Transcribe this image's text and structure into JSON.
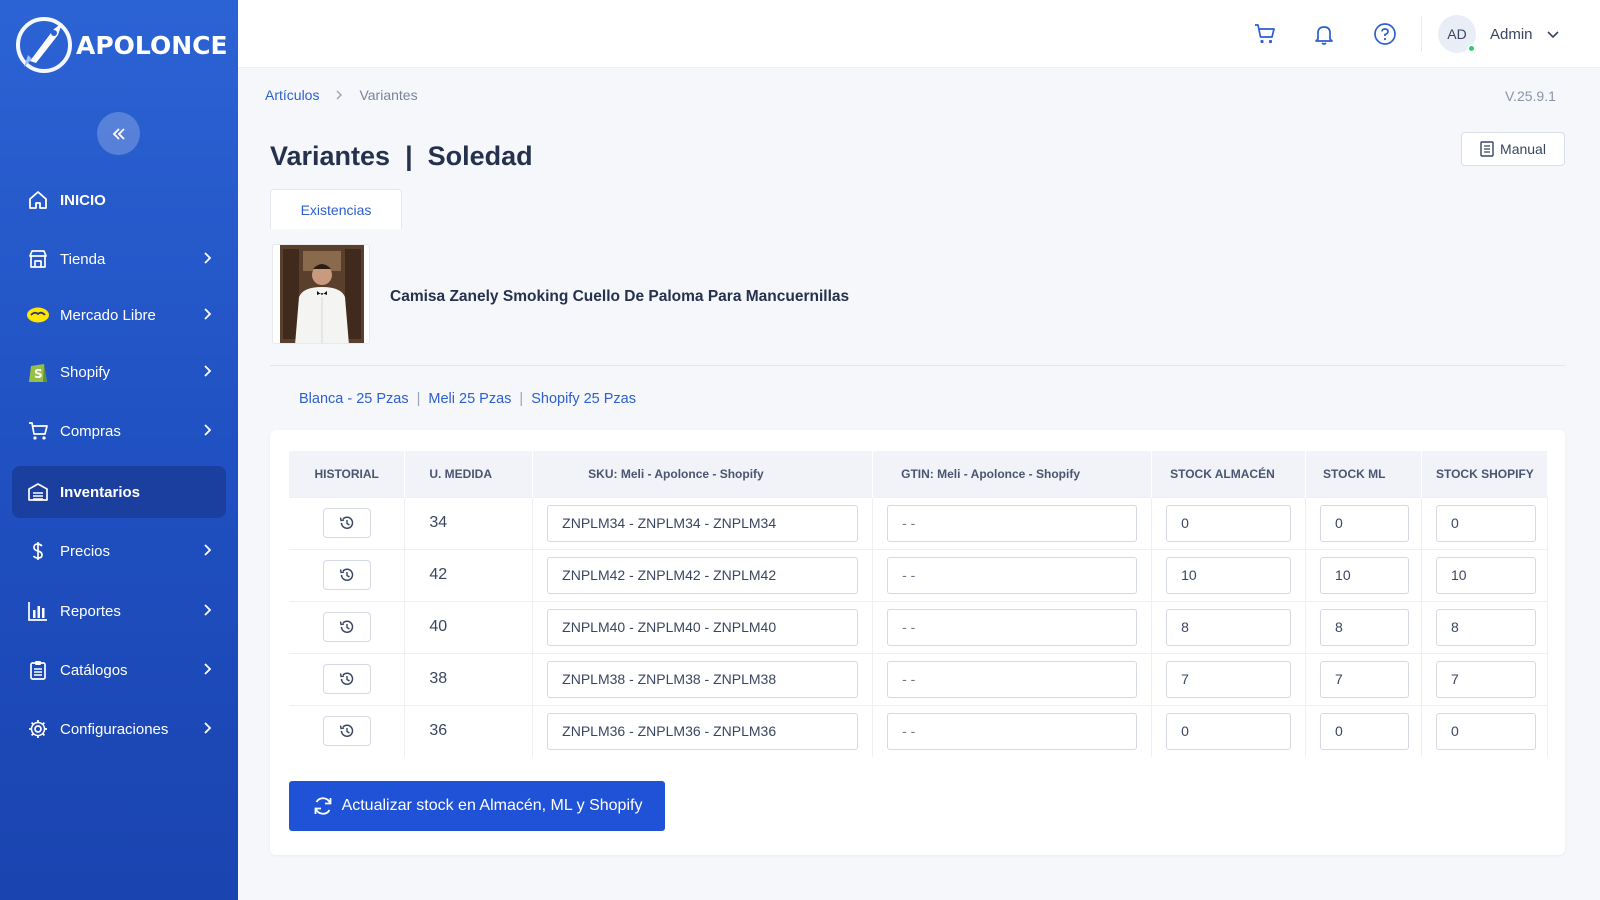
{
  "app": {
    "logo_text": "APOLONCE",
    "version": "V.25.9.1"
  },
  "sidebar": {
    "items": [
      {
        "label": "INICIO",
        "icon": "home-icon"
      },
      {
        "label": "Tienda",
        "icon": "store-icon"
      },
      {
        "label": "Mercado Libre",
        "icon": "mercado-libre-icon"
      },
      {
        "label": "Shopify",
        "icon": "shopify-icon"
      },
      {
        "label": "Compras",
        "icon": "cart-icon"
      },
      {
        "label": "Inventarios",
        "icon": "inventory-icon",
        "active": true
      },
      {
        "label": "Precios",
        "icon": "dollar-icon"
      },
      {
        "label": "Reportes",
        "icon": "bar-chart-icon"
      },
      {
        "label": "Catálogos",
        "icon": "clipboard-icon"
      },
      {
        "label": "Configuraciones",
        "icon": "gear-icon"
      }
    ]
  },
  "topbar": {
    "avatar_initials": "AD",
    "user_name": "Admin"
  },
  "breadcrumb": {
    "parent": "Artículos",
    "current": "Variantes"
  },
  "page": {
    "title": "Variantes  |  Soledad",
    "manual_label": "Manual",
    "tab_label": "Existencias",
    "product_name": "Camisa Zanely Smoking Cuello De Paloma Para Mancuernillas"
  },
  "summary": {
    "color": "Blanca - 25 Pzas",
    "meli": "Meli 25 Pzas",
    "shopify": "Shopify 25 Pzas"
  },
  "table": {
    "headers": {
      "historial": "HISTORIAL",
      "medida": "U. MEDIDA",
      "sku": "SKU: Meli - Apolonce - Shopify",
      "gtin": "GTIN: Meli - Apolonce - Shopify",
      "almacen": "STOCK ALMACÉN",
      "ml": "STOCK ML",
      "shopify": "STOCK SHOPIFY"
    },
    "rows": [
      {
        "medida": "34",
        "sku": "ZNPLM34 - ZNPLM34 - ZNPLM34",
        "gtin": "- -",
        "almacen": "0",
        "ml": "0",
        "shopify": "0"
      },
      {
        "medida": "42",
        "sku": "ZNPLM42 - ZNPLM42 - ZNPLM42",
        "gtin": "- -",
        "almacen": "10",
        "ml": "10",
        "shopify": "10"
      },
      {
        "medida": "40",
        "sku": "ZNPLM40 - ZNPLM40 - ZNPLM40",
        "gtin": "- -",
        "almacen": "8",
        "ml": "8",
        "shopify": "8"
      },
      {
        "medida": "38",
        "sku": "ZNPLM38 - ZNPLM38 - ZNPLM38",
        "gtin": "- -",
        "almacen": "7",
        "ml": "7",
        "shopify": "7"
      },
      {
        "medida": "36",
        "sku": "ZNPLM36 - ZNPLM36 - ZNPLM36",
        "gtin": "- -",
        "almacen": "0",
        "ml": "0",
        "shopify": "0"
      }
    ]
  },
  "update_button": "Actualizar stock en Almacén, ML y Shopify",
  "colors": {
    "sidebar": "#2c63d4",
    "active_nav": "#1b3f9e",
    "primary": "#1f52d6",
    "link": "#2d5fcf"
  }
}
